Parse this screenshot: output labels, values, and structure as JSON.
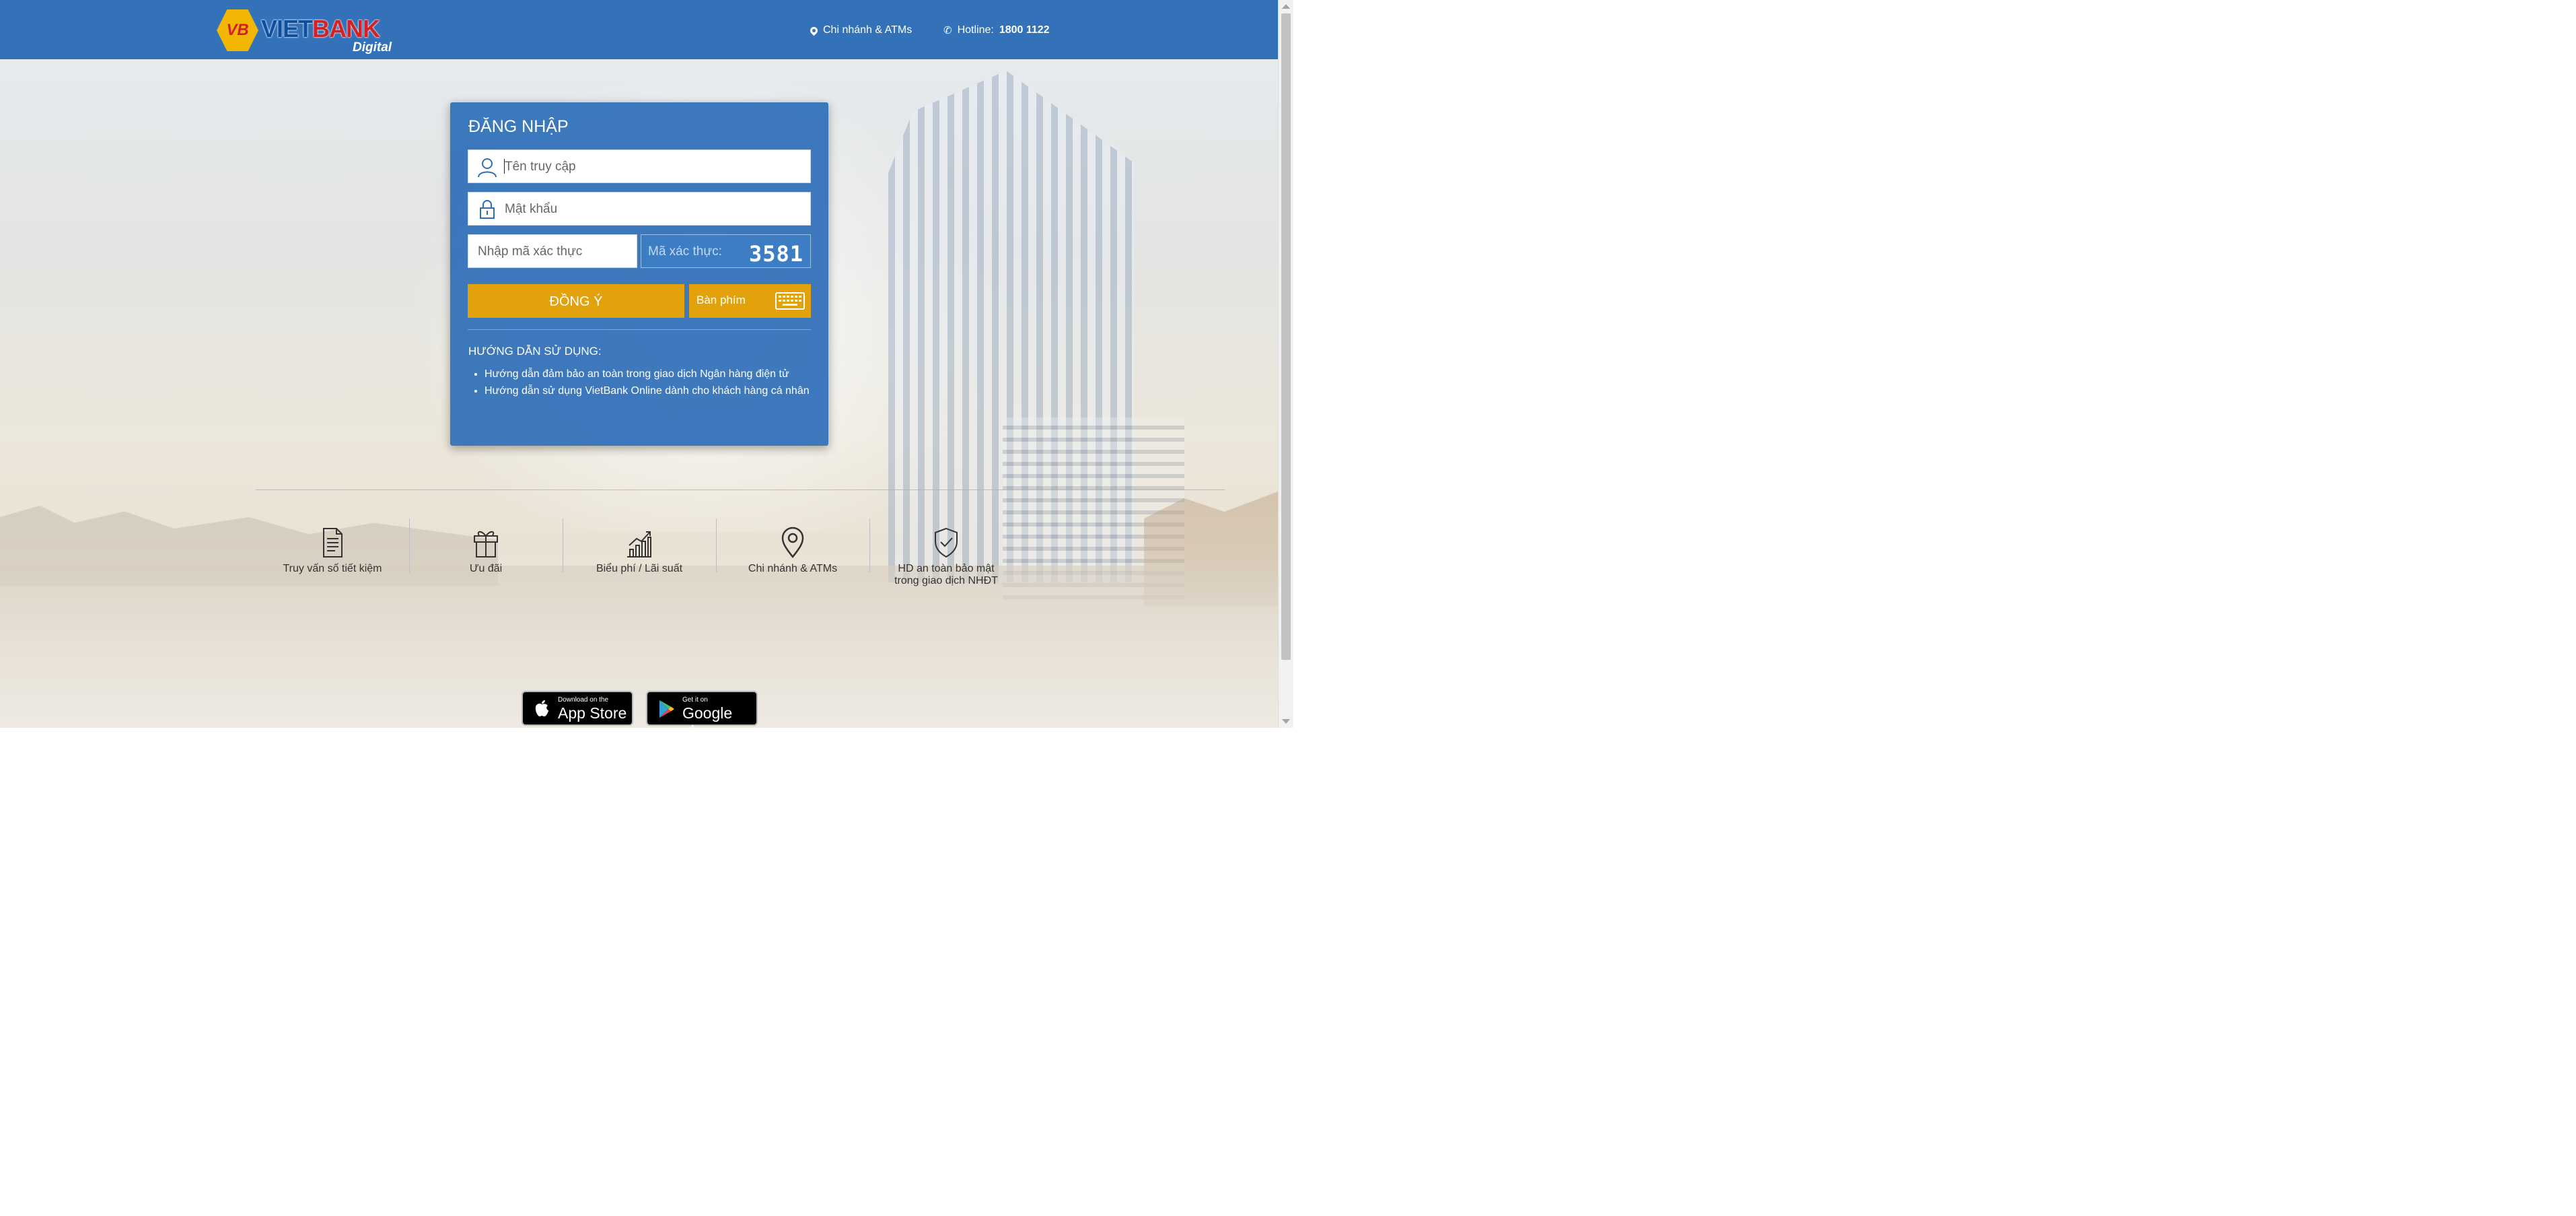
{
  "header": {
    "logo": {
      "mark": "VB",
      "brand_part1": "VIET",
      "brand_part2": "BANK",
      "tagline": "Digital"
    },
    "branches_label": "Chi nhánh & ATMs",
    "hotline_label": "Hotline:",
    "hotline_number": "1800 1122"
  },
  "login": {
    "title": "ĐĂNG NHẬP",
    "username_placeholder": "Tên truy cập",
    "password_placeholder": "Mật khẩu",
    "captcha_placeholder": "Nhập mã xác thực",
    "captcha_label": "Mã xác thực:",
    "captcha_code": "3581",
    "submit_label": "ĐỒNG Ý",
    "keyboard_label": "Bàn phím"
  },
  "guide": {
    "title": "HƯỚNG DẪN SỬ DỤNG:",
    "items": [
      "Hướng dẫn đảm bảo an toàn trong giao dịch Ngân hàng điện tử",
      "Hướng dẫn sử dụng VietBank Online dành cho khách hàng cá nhân"
    ]
  },
  "features": [
    {
      "label": "Truy vấn số tiết kiệm",
      "icon": "document-icon"
    },
    {
      "label": "Ưu đãi",
      "icon": "gift-icon"
    },
    {
      "label": "Biểu phí / Lãi suất",
      "icon": "chart-icon"
    },
    {
      "label": "Chi nhánh & ATMs",
      "icon": "map-pin-icon"
    },
    {
      "label": "HD an toàn bảo mật trong giao dịch NHĐT",
      "icon": "shield-check-icon"
    }
  ],
  "apps": {
    "apple_small": "Download on the",
    "apple_big": "App Store",
    "google_small": "Get it on",
    "google_big": "Google play"
  },
  "colors": {
    "header_blue": "#3372b8",
    "panel_blue": "#2e6eb7",
    "accent_amber": "#e3a20b",
    "brand_red": "#d42027",
    "brand_yellow": "#f2b705"
  }
}
